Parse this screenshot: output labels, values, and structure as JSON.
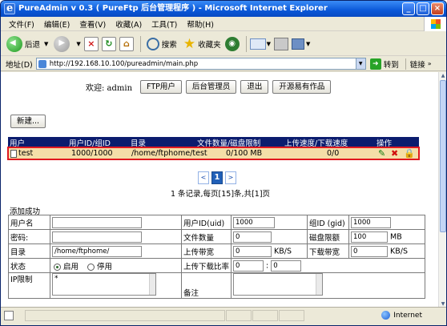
{
  "window": {
    "title": "PureAdmin v 0.3 ( PureFtp 后台管理程序 ) - Microsoft Internet Explorer",
    "minimize": "_",
    "maximize": "□",
    "close": "×"
  },
  "menu": [
    "文件(F)",
    "编辑(E)",
    "查看(V)",
    "收藏(A)",
    "工具(T)",
    "帮助(H)"
  ],
  "toolbar": {
    "back": "后退",
    "search": "搜索",
    "favorites": "收藏夹"
  },
  "address": {
    "label": "地址(D)",
    "url": "http://192.168.10.100/pureadmin/main.php",
    "go": "转到",
    "links": "链接"
  },
  "welcome": {
    "text": "欢迎: admin",
    "buttons": [
      "FTP用户",
      "后台管理员",
      "退出",
      "开源易有作品"
    ]
  },
  "new_button": "新建...",
  "user_table": {
    "headers": [
      "用户",
      "用户ID/组ID",
      "目录",
      "文件数量/磁盘限制",
      "上传速度/下载速度",
      "操作"
    ],
    "rows": [
      {
        "user": "test",
        "ids": "1000/1000",
        "dir": "/home/ftphome/test",
        "quota": "0/100 MB",
        "speed": "0/0"
      }
    ]
  },
  "pager": {
    "prev": "<",
    "current": "1",
    "next": ">",
    "info": "1 条记录,每页[15]条,共[1]页"
  },
  "add_form": {
    "title": "添加成功",
    "username_label": "用户名",
    "uid_label": "用户ID(uid)",
    "uid_value": "1000",
    "gid_label": "组ID (gid)",
    "gid_value": "1000",
    "password_label": "密码:",
    "files_label": "文件数量",
    "files_value": "0",
    "quota_label": "磁盘限额",
    "quota_value": "100",
    "quota_unit": "MB",
    "dir_label": "目录",
    "dir_value": "/home/ftphome/",
    "upbw_label": "上传带宽",
    "upbw_value": "0",
    "upbw_unit": "KB/S",
    "downbw_label": "下载带宽",
    "downbw_value": "0",
    "downbw_unit": "KB/S",
    "status_label": "状态",
    "status_on": "启用",
    "status_off": "停用",
    "ratio_label": "上传下载比率",
    "ratio_up": "0",
    "ratio_sep": ":",
    "ratio_down": "0",
    "ip_label": "IP限制",
    "ip_value": "*",
    "note_label": "备注"
  },
  "status": {
    "zone": "Internet"
  },
  "colors": {
    "header_bg": "#0b1c6e",
    "row_bg": "#f4dea8",
    "highlight_border": "#e0191f"
  }
}
